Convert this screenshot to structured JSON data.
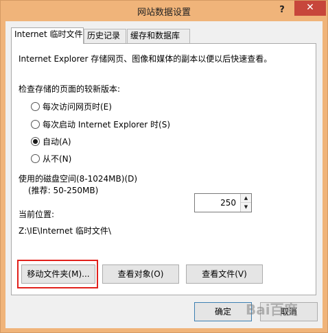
{
  "window": {
    "title": "网站数据设置",
    "help": "?",
    "close": "✕"
  },
  "tabs": [
    {
      "label": "Internet 临时文件"
    },
    {
      "label": "历史记录"
    },
    {
      "label": "缓存和数据库"
    }
  ],
  "panel": {
    "description": "Internet Explorer 存储网页、图像和媒体的副本以便以后快速查看。",
    "check_heading": "检查存储的页面的较新版本:",
    "options": [
      {
        "label": "每次访问网页时(E)",
        "checked": false
      },
      {
        "label": "每次启动 Internet Explorer 时(S)",
        "checked": false
      },
      {
        "label": "自动(A)",
        "checked": true
      },
      {
        "label": "从不(N)",
        "checked": false
      }
    ],
    "disk_label": "使用的磁盘空间(8-1024MB)(D)",
    "disk_recommend": "(推荐: 50-250MB)",
    "disk_value": "250",
    "location_label": "当前位置:",
    "location_path": "Z:\\IE\\Internet 临时文件\\",
    "buttons": {
      "move": "移动文件夹(M)...",
      "view_objects": "查看对象(O)",
      "view_files": "查看文件(V)"
    }
  },
  "footer": {
    "ok": "确定",
    "cancel": "取消"
  },
  "watermark": "Bai百度"
}
